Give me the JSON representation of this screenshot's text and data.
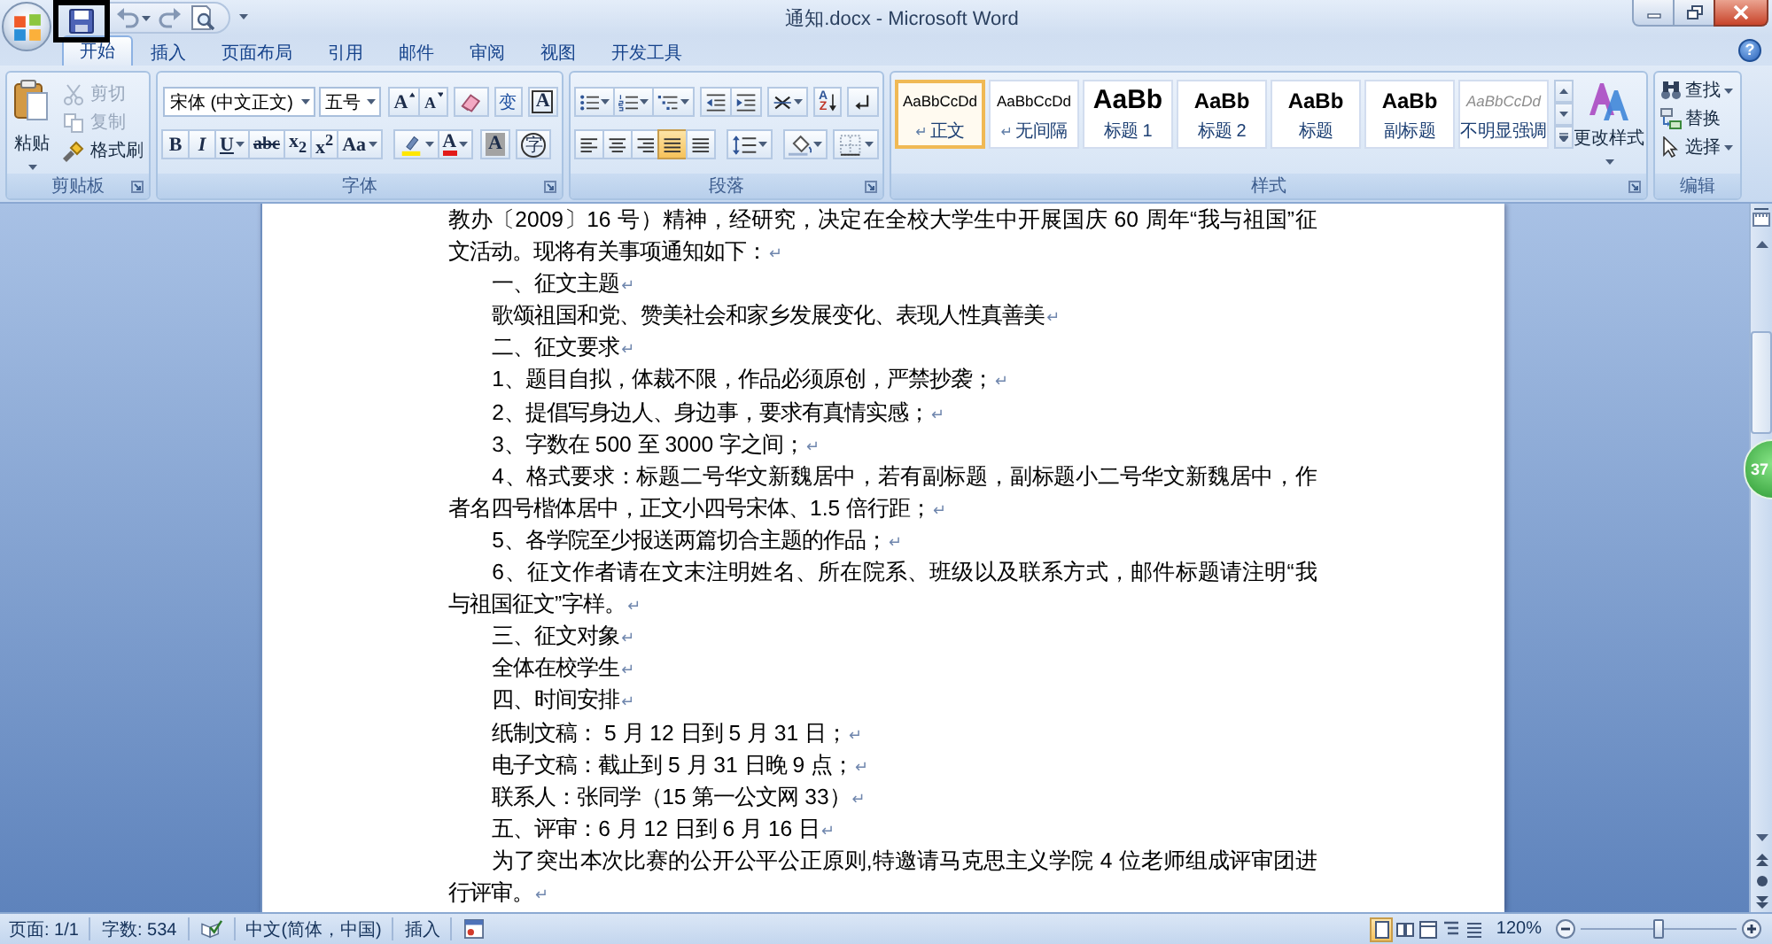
{
  "window": {
    "title": "通知.docx - Microsoft Word"
  },
  "quick_access": {
    "save_highlighted": true
  },
  "tabs": [
    {
      "label": "开始",
      "selected": true
    },
    {
      "label": "插入",
      "selected": false
    },
    {
      "label": "页面布局",
      "selected": false
    },
    {
      "label": "引用",
      "selected": false
    },
    {
      "label": "邮件",
      "selected": false
    },
    {
      "label": "审阅",
      "selected": false
    },
    {
      "label": "视图",
      "selected": false
    },
    {
      "label": "开发工具",
      "selected": false
    }
  ],
  "help": "?",
  "clipboard": {
    "label": "剪贴板",
    "paste": "粘贴",
    "items": [
      {
        "label": "剪切",
        "disabled": true
      },
      {
        "label": "复制",
        "disabled": true
      },
      {
        "label": "格式刷",
        "disabled": false
      }
    ]
  },
  "font": {
    "label": "字体",
    "name": "宋体 (中文正文)",
    "size": "五号",
    "grow": "A",
    "shrink": "A",
    "phonetic": "变",
    "border": "A",
    "bold": "B",
    "italic": "I",
    "underline": "U",
    "strike": "abc",
    "subscript": "x$_{2}$",
    "superscript": "x$^{2}$",
    "case": "Aa",
    "tint_letter": "A",
    "shading": "A",
    "enclose": "字"
  },
  "paragraph": {
    "label": "段落",
    "sort": [
      "A",
      "Z"
    ],
    "alignment": [
      {
        "selected": false
      },
      {
        "selected": false
      },
      {
        "selected": false
      },
      {
        "selected": true
      },
      {
        "selected": false
      }
    ]
  },
  "styles": {
    "label": "样式",
    "change": "更改样式",
    "items": [
      {
        "preview": "AaBbCcDd",
        "name": "正文",
        "mark": "↵",
        "kind": "plain",
        "selected": true
      },
      {
        "preview": "AaBbCcDd",
        "name": "无间隔",
        "mark": "↵",
        "kind": "plain",
        "selected": false
      },
      {
        "preview": "AaBb",
        "name": "标题 1",
        "kind": "large",
        "selected": false
      },
      {
        "preview": "AaBb",
        "name": "标题 2",
        "kind": "medium",
        "selected": false
      },
      {
        "preview": "AaBb",
        "name": "标题",
        "kind": "medium",
        "selected": false
      },
      {
        "preview": "AaBb",
        "name": "副标题",
        "kind": "medium",
        "selected": false
      },
      {
        "preview": "AaBbCcDd",
        "name": "不明显强调",
        "kind": "subtle",
        "selected": false
      }
    ]
  },
  "editing": {
    "label": "编辑",
    "items": [
      {
        "label": "查找",
        "menu": true
      },
      {
        "label": "替换",
        "menu": false
      },
      {
        "label": "选择",
        "menu": true
      }
    ]
  },
  "document": {
    "paragraphs": [
      {
        "kind": "continued",
        "lines": [
          "教办〔2009〕16 号）精神，经研究，决定在全校大学生中开展国庆 60 周年“我与祖国”征",
          "文活动。现将有关事项通知如下："
        ],
        "mark": "↵"
      },
      {
        "kind": "indented",
        "lines": [
          "一、征文主题"
        ],
        "mark": "↵"
      },
      {
        "kind": "indented",
        "lines": [
          "歌颂祖国和党、赞美社会和家乡发展变化、表现人性真善美"
        ],
        "mark": "↵"
      },
      {
        "kind": "indented",
        "lines": [
          "二、征文要求"
        ],
        "mark": "↵"
      },
      {
        "kind": "indented",
        "lines": [
          "1、题目自拟，体裁不限，作品必须原创，严禁抄袭；"
        ],
        "mark": "↵"
      },
      {
        "kind": "indented",
        "lines": [
          "2、提倡写身边人、身边事，要求有真情实感；"
        ],
        "mark": "↵"
      },
      {
        "kind": "indented",
        "lines": [
          "3、字数在 500 至 3000 字之间；"
        ],
        "mark": "↵"
      },
      {
        "kind": "indented",
        "lines": [
          "4、格式要求：标题二号华文新魏居中，若有副标题，副标题小二号华文新魏居中，作",
          "者名四号楷体居中，正文小四号宋体、1.5 倍行距；"
        ],
        "mark": "↵"
      },
      {
        "kind": "indented",
        "lines": [
          "5、各学院至少报送两篇切合主题的作品；"
        ],
        "mark": "↵"
      },
      {
        "kind": "indented",
        "lines": [
          "6、征文作者请在文末注明姓名、所在院系、班级以及联系方式，邮件标题请注明“我",
          "与祖国征文”字样。"
        ],
        "mark": "↵"
      },
      {
        "kind": "indented",
        "lines": [
          "三、征文对象"
        ],
        "mark": "↵"
      },
      {
        "kind": "indented",
        "lines": [
          "全体在校学生"
        ],
        "mark": "↵"
      },
      {
        "kind": "indented",
        "lines": [
          "四、时间安排"
        ],
        "mark": "↵"
      },
      {
        "kind": "indented",
        "lines": [
          "纸制文稿： 5 月 12 日到 5 月 31 日；"
        ],
        "mark": "↵"
      },
      {
        "kind": "indented",
        "lines": [
          "电子文稿：截止到 5 月 31 日晚 9 点；"
        ],
        "mark": "↵"
      },
      {
        "kind": "indented",
        "lines": [
          "联系人：张同学（15 第一公文网 33）"
        ],
        "mark": "↵"
      },
      {
        "kind": "indented",
        "lines": [
          "五、评审：6 月 12 日到 6 月 16 日"
        ],
        "mark": "↵"
      },
      {
        "kind": "indented",
        "lines": [
          "为了突出本次比赛的公开公平公正原则,特邀请马克思主义学院 4 位老师组成评审团进",
          "行评审。"
        ],
        "mark": "↵"
      }
    ]
  },
  "badge": {
    "text": "37"
  },
  "status_bar": {
    "page": "页面: 1/1",
    "words": "字数: 534",
    "language": "中文(简体，中国)",
    "mode": "插入",
    "views": [
      {
        "selected": true
      },
      {
        "selected": false
      },
      {
        "selected": false
      },
      {
        "selected": false
      },
      {
        "selected": false
      }
    ],
    "zoom": "120%",
    "zoom_slider": {
      "level": 0.5
    }
  }
}
